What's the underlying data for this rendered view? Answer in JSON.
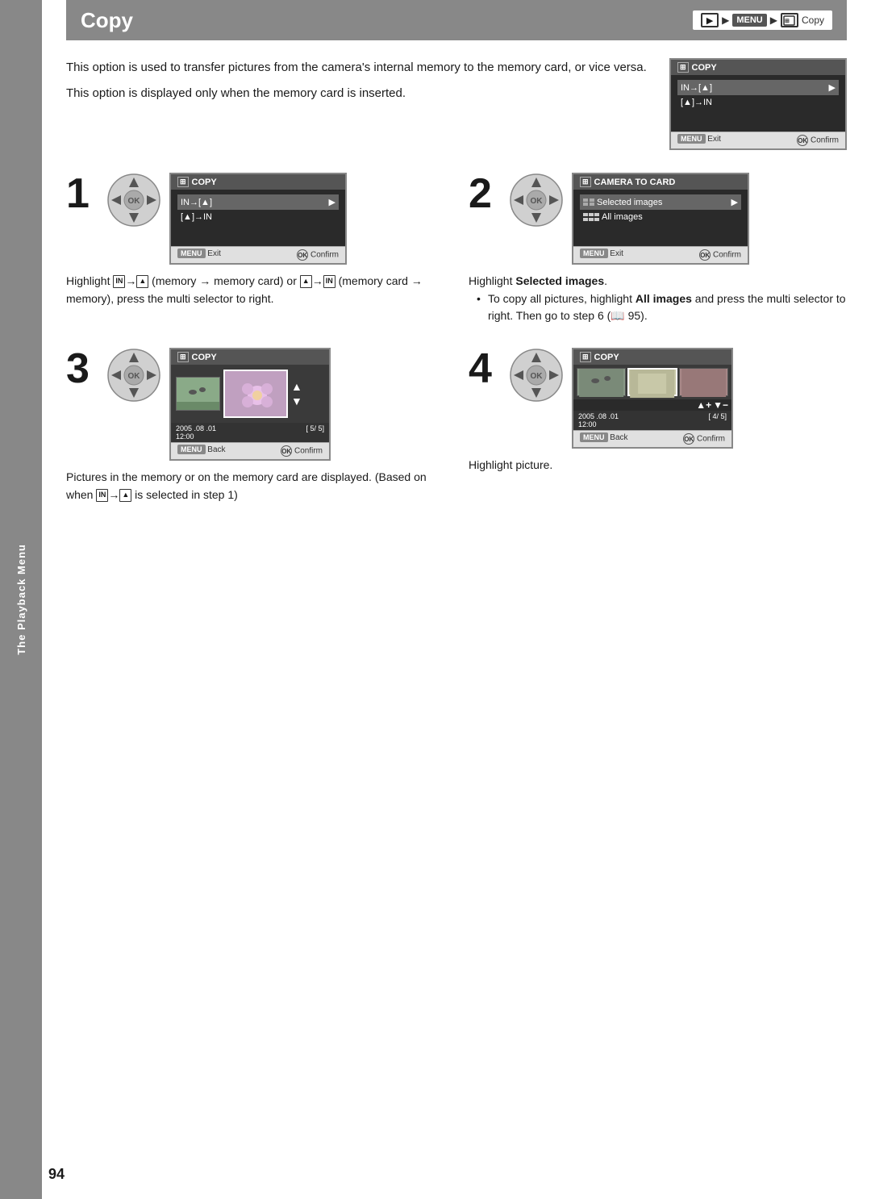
{
  "sidebar": {
    "label": "The Playback Menu"
  },
  "header": {
    "title": "Copy",
    "breadcrumb": {
      "play_icon": "▶",
      "arrow1": "▶",
      "menu_label": "MENU",
      "arrow2": "▶",
      "copy_label": "Copy"
    }
  },
  "intro": {
    "paragraph1": "This option is used to transfer pictures from the camera's internal memory to the memory card, or vice versa.",
    "paragraph2": "This option is displayed only when the memory card is inserted."
  },
  "copy_screen_top": {
    "title": "COPY",
    "item1": "IN→[^]",
    "item2": "[^]→IN",
    "footer_exit": "Exit",
    "footer_confirm": "Confirm"
  },
  "steps": [
    {
      "number": "1",
      "screen_title": "COPY",
      "screen_item1": "IN→[^]",
      "screen_item2": "[^]→IN",
      "footer_exit": "Exit",
      "footer_confirm": "Confirm",
      "description_parts": {
        "highlight": "Highlight",
        "mem_to_card": "IN→[^]",
        "text1": "(memory → memory card) or",
        "card_to_mem": "[^]→IN",
        "text2": "(memory card → memory), press the multi selector to right."
      }
    },
    {
      "number": "2",
      "screen_title": "CAMERA TO CARD",
      "screen_item1": "Selected images",
      "screen_item2": "All images",
      "footer_exit": "Exit",
      "footer_confirm": "Confirm",
      "description": "Highlight Selected images.",
      "bullet": "To copy all pictures, highlight All images and press the multi selector to right. Then go to step 6 (🔖 95)."
    },
    {
      "number": "3",
      "screen_title": "COPY",
      "date": "2005 .08 .01",
      "time": "12:00",
      "frame_info": "[ 5/ 5]",
      "footer_back": "Back",
      "footer_confirm": "Confirm",
      "description": "Pictures in the memory or on the memory card are displayed. (Based on when IN→[^] is selected in step 1)"
    },
    {
      "number": "4",
      "screen_title": "COPY",
      "date": "2005 .08 .01",
      "time": "12:00",
      "frame_info": "[ 4/ 5]",
      "footer_back": "Back",
      "footer_confirm": "Confirm",
      "description": "Highlight picture."
    }
  ],
  "page_number": "94"
}
